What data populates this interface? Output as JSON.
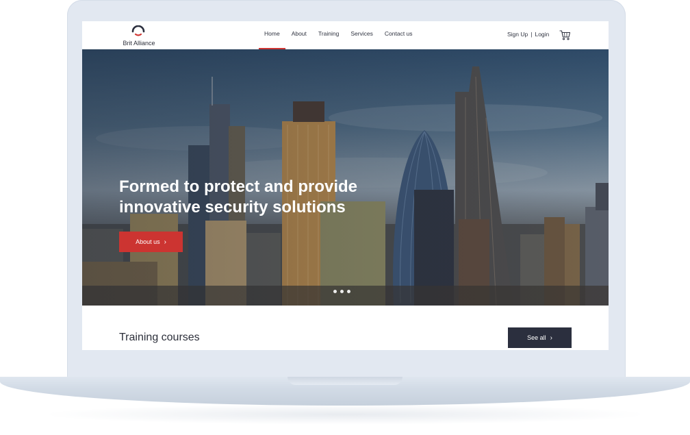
{
  "brand": {
    "name": "Brit Alliance",
    "accent": "#d03532",
    "dark": "#2b2f3e"
  },
  "nav": {
    "items": [
      {
        "label": "Home",
        "active": true
      },
      {
        "label": "About"
      },
      {
        "label": "Training"
      },
      {
        "label": "Services"
      },
      {
        "label": "Contact us"
      }
    ]
  },
  "auth": {
    "signup": "Sign Up",
    "separator": "|",
    "login": "Login",
    "cart_icon": "cart-icon"
  },
  "hero": {
    "title": "Formed to protect and provide innovative security solutions",
    "button_label": "About us",
    "slide_count": 3
  },
  "training": {
    "title": "Training courses",
    "button_label": "See all"
  },
  "chevron": "›"
}
